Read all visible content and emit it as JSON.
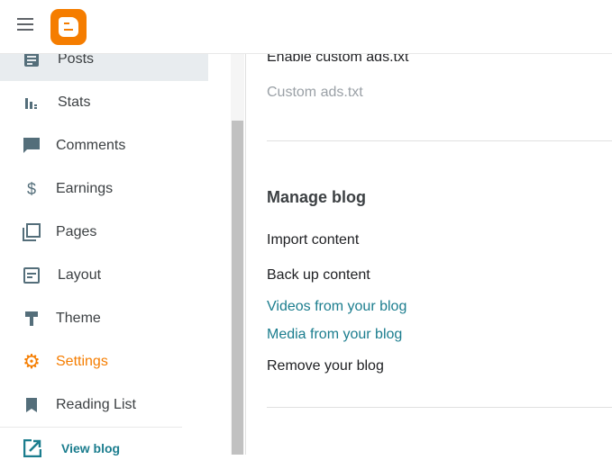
{
  "header": {
    "menu_icon": "hamburger-icon",
    "logo": "blogger-logo",
    "brand_color": "#f57d00"
  },
  "sidebar": {
    "items": [
      {
        "label": "Posts",
        "icon": "posts-icon",
        "active": true
      },
      {
        "label": "Stats",
        "icon": "stats-icon"
      },
      {
        "label": "Comments",
        "icon": "comment-icon"
      },
      {
        "label": "Earnings",
        "icon": "dollar-icon"
      },
      {
        "label": "Pages",
        "icon": "pages-icon"
      },
      {
        "label": "Layout",
        "icon": "layout-icon"
      },
      {
        "label": "Theme",
        "icon": "paint-roller-icon"
      },
      {
        "label": "Settings",
        "icon": "gear-icon",
        "selected": true
      },
      {
        "label": "Reading List",
        "icon": "bookmark-icon"
      }
    ],
    "view_blog": "View blog"
  },
  "main": {
    "enable_custom_ads": "Enable custom ads.txt",
    "custom_ads": "Custom ads.txt",
    "manage_blog": {
      "title": "Manage blog",
      "import": "Import content",
      "backup": "Back up content",
      "videos": "Videos from your blog",
      "media": "Media from your blog",
      "remove": "Remove your blog"
    }
  },
  "colors": {
    "accent": "#f57d00",
    "link": "#1b7d8e"
  }
}
